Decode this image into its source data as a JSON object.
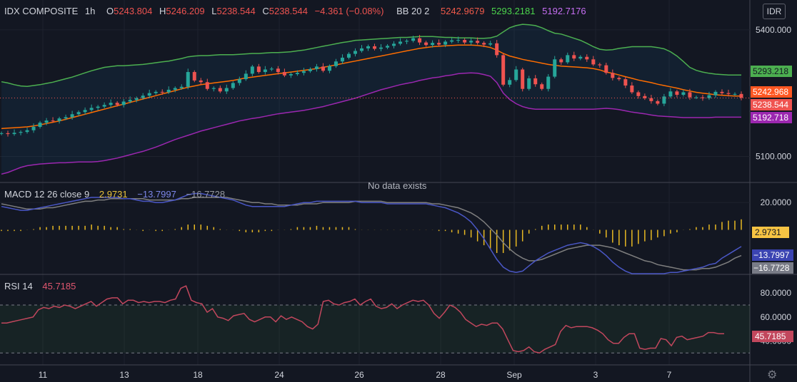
{
  "header": {
    "symbol": "IDX COMPOSITE",
    "interval": "1h",
    "o_label": "O",
    "o_value": "5243.804",
    "h_label": "H",
    "h_value": "5246.209",
    "l_label": "L",
    "l_value": "5238.544",
    "c_label": "C",
    "c_value": "5238.544",
    "change": "−4.361 (−0.08%)",
    "bb_label": "BB 20 2",
    "bb_mid": "5242.9679",
    "bb_upper": "5293.2181",
    "bb_lower": "5192.7176",
    "currency": "IDR"
  },
  "macd": {
    "label": "MACD 12 26 close 9",
    "hist": "2.9731",
    "macd": "−13.7997",
    "signal": "−16.7728",
    "no_data": "No data exists"
  },
  "rsi": {
    "label": "RSI 14",
    "value": "45.7185"
  },
  "colors": {
    "background": "#131722",
    "up": "#26a69a",
    "down": "#ef5350",
    "bb_upper": "#4caf50",
    "bb_mid": "#ff6d00",
    "bb_lower": "#9c27b0",
    "macd_line": "#4a57c6",
    "signal_line": "#7f7f7f",
    "histogram": "#e8b923",
    "rsi_line": "#c2475d"
  },
  "chart_data": [
    {
      "type": "candlestick",
      "title": "IDX COMPOSITE, 1h",
      "x_labels": [
        "11",
        "13",
        "18",
        "24",
        "26",
        "28",
        "Sep",
        "3",
        "7"
      ],
      "y_ticks": [
        "5400.000",
        "5100.000"
      ],
      "ylim": [
        5040,
        5420
      ],
      "price_tags": {
        "bb_upper": "5293.218",
        "bb_mid": "5242.968",
        "close": "5238.544",
        "bb_lower": "5192.718"
      },
      "close": [
        5155,
        5153,
        5156,
        5158,
        5162,
        5170,
        5180,
        5185,
        5184,
        5190,
        5193,
        5200,
        5205,
        5210,
        5215,
        5218,
        5222,
        5227,
        5222,
        5230,
        5234,
        5238,
        5244,
        5250,
        5253,
        5252,
        5258,
        5262,
        5265,
        5300,
        5280,
        5276,
        5260,
        5262,
        5254,
        5262,
        5274,
        5283,
        5296,
        5313,
        5300,
        5306,
        5308,
        5300,
        5292,
        5295,
        5298,
        5302,
        5307,
        5313,
        5303,
        5314,
        5325,
        5334,
        5343,
        5350,
        5356,
        5361,
        5355,
        5358,
        5362,
        5367,
        5372,
        5374,
        5380,
        5370,
        5364,
        5369,
        5365,
        5372,
        5375,
        5376,
        5370,
        5374,
        5369,
        5365,
        5368,
        5340,
        5270,
        5281,
        5306,
        5260,
        5285,
        5271,
        5260,
        5289,
        5330,
        5323,
        5340,
        5332,
        5336,
        5330,
        5318,
        5316,
        5298,
        5286,
        5283,
        5268,
        5252,
        5243,
        5238,
        5231,
        5225,
        5242,
        5254,
        5246,
        5252,
        5240,
        5240,
        5238,
        5245,
        5253,
        5250,
        5248,
        5248,
        5239
      ],
      "series": [
        {
          "name": "BB 20 2 upper",
          "values": [
            5277,
            5274,
            5270,
            5267,
            5266,
            5268,
            5270,
            5273,
            5276,
            5280,
            5284,
            5288,
            5293,
            5298,
            5303,
            5307,
            5311,
            5313,
            5315,
            5315,
            5316,
            5317,
            5318,
            5320,
            5322,
            5324,
            5326,
            5329,
            5332,
            5336,
            5338,
            5339,
            5339,
            5340,
            5341,
            5341,
            5341,
            5342,
            5343,
            5344,
            5344,
            5345,
            5346,
            5346,
            5347,
            5348,
            5350,
            5352,
            5355,
            5358,
            5361,
            5364,
            5367,
            5370,
            5372,
            5375,
            5376,
            5377,
            5378,
            5379,
            5380,
            5381,
            5382,
            5382,
            5383,
            5384,
            5384,
            5384,
            5383,
            5382,
            5382,
            5381,
            5381,
            5381,
            5380,
            5380,
            5381,
            5385,
            5395,
            5405,
            5410,
            5413,
            5412,
            5410,
            5405,
            5398,
            5392,
            5390,
            5385,
            5380,
            5375,
            5368,
            5360,
            5354,
            5352,
            5353,
            5356,
            5358,
            5360,
            5360,
            5360,
            5360,
            5358,
            5355,
            5348,
            5338,
            5325,
            5311,
            5304,
            5300,
            5297,
            5295,
            5294,
            5293,
            5293,
            5293
          ]
        },
        {
          "name": "BB 20 2 basis",
          "values": [
            5166,
            5167,
            5168,
            5169,
            5170,
            5172,
            5175,
            5178,
            5181,
            5184,
            5188,
            5192,
            5196,
            5200,
            5204,
            5208,
            5212,
            5216,
            5220,
            5224,
            5228,
            5232,
            5236,
            5240,
            5244,
            5248,
            5252,
            5256,
            5260,
            5264,
            5267,
            5270,
            5272,
            5274,
            5276,
            5278,
            5280,
            5283,
            5286,
            5288,
            5290,
            5292,
            5294,
            5296,
            5298,
            5300,
            5302,
            5304,
            5306,
            5308,
            5311,
            5314,
            5317,
            5320,
            5323,
            5326,
            5329,
            5332,
            5335,
            5338,
            5341,
            5344,
            5347,
            5350,
            5353,
            5356,
            5358,
            5360,
            5361,
            5362,
            5363,
            5364,
            5364,
            5364,
            5363,
            5361,
            5358,
            5352,
            5344,
            5338,
            5334,
            5330,
            5327,
            5324,
            5321,
            5318,
            5316,
            5314,
            5313,
            5312,
            5311,
            5310,
            5308,
            5305,
            5300,
            5297,
            5293,
            5289,
            5285,
            5281,
            5278,
            5275,
            5271,
            5268,
            5265,
            5262,
            5258,
            5255,
            5252,
            5250,
            5248,
            5246,
            5245,
            5244,
            5243,
            5243
          ]
        },
        {
          "name": "BB 20 2 lower",
          "values": [
            5058,
            5062,
            5068,
            5074,
            5078,
            5080,
            5082,
            5083,
            5084,
            5085,
            5085,
            5086,
            5087,
            5087,
            5087,
            5088,
            5090,
            5093,
            5096,
            5100,
            5104,
            5108,
            5112,
            5117,
            5122,
            5128,
            5134,
            5140,
            5145,
            5150,
            5155,
            5160,
            5164,
            5168,
            5172,
            5176,
            5180,
            5184,
            5187,
            5190,
            5192,
            5195,
            5198,
            5201,
            5203,
            5205,
            5207,
            5209,
            5212,
            5215,
            5218,
            5222,
            5226,
            5230,
            5234,
            5238,
            5243,
            5248,
            5253,
            5258,
            5262,
            5266,
            5270,
            5273,
            5276,
            5280,
            5283,
            5286,
            5288,
            5291,
            5293,
            5296,
            5297,
            5298,
            5297,
            5294,
            5290,
            5275,
            5250,
            5235,
            5225,
            5218,
            5214,
            5212,
            5212,
            5212,
            5212,
            5212,
            5212,
            5212,
            5212,
            5212,
            5212,
            5213,
            5214,
            5213,
            5211,
            5208,
            5205,
            5203,
            5201,
            5198,
            5196,
            5195,
            5194,
            5193,
            5192,
            5192,
            5192,
            5192,
            5192,
            5193,
            5193,
            5193,
            5193,
            5193
          ]
        }
      ]
    },
    {
      "type": "line",
      "title": "MACD 12 26 close 9",
      "y_ticks": [
        "20.0000"
      ],
      "price_tags": {
        "histogram": "2.9731",
        "macd": "−13.7997",
        "signal": "−16.7728"
      },
      "ylim": [
        -35,
        35
      ],
      "series": [
        {
          "name": "MACD",
          "values": [
            17,
            16,
            15,
            14,
            14,
            15,
            16,
            17,
            18,
            19,
            20,
            21,
            22,
            23,
            24,
            24,
            24,
            24,
            24,
            23,
            23,
            22,
            21,
            21,
            20,
            20,
            21,
            22,
            24,
            26,
            27,
            27,
            26,
            25,
            24,
            23,
            22,
            20,
            18,
            17,
            17,
            17,
            17,
            17,
            17,
            18,
            19,
            20,
            20,
            21,
            21,
            21,
            21,
            21,
            21,
            21,
            20,
            20,
            20,
            20,
            19,
            19,
            19,
            19,
            19,
            19,
            19,
            18,
            17,
            16,
            14,
            12,
            9,
            5,
            -1,
            -8,
            -16,
            -24,
            -30,
            -33,
            -34,
            -33,
            -29,
            -25,
            -22,
            -19,
            -17,
            -15,
            -13,
            -12,
            -11,
            -12,
            -14,
            -17,
            -21,
            -26,
            -30,
            -33,
            -35,
            -35,
            -35,
            -35,
            -35,
            -35,
            -34,
            -34,
            -33,
            -32,
            -31,
            -30,
            -28,
            -27,
            -23,
            -20,
            -17,
            -14
          ]
        },
        {
          "name": "Signal",
          "values": [
            19,
            18,
            17,
            16,
            15,
            15,
            15,
            16,
            16,
            17,
            18,
            19,
            20,
            21,
            21,
            22,
            22,
            23,
            23,
            23,
            23,
            23,
            23,
            22,
            22,
            22,
            22,
            22,
            23,
            23,
            24,
            24,
            24,
            24,
            24,
            24,
            23,
            22,
            21,
            20,
            20,
            19,
            19,
            18,
            18,
            18,
            18,
            19,
            19,
            19,
            20,
            20,
            20,
            20,
            20,
            21,
            21,
            21,
            21,
            21,
            20,
            20,
            20,
            20,
            20,
            20,
            20,
            19,
            19,
            18,
            17,
            16,
            14,
            12,
            9,
            5,
            0,
            -5,
            -11,
            -16,
            -20,
            -23,
            -25,
            -25,
            -24,
            -22,
            -20,
            -18,
            -16,
            -15,
            -14,
            -13,
            -13,
            -13,
            -14,
            -15,
            -17,
            -19,
            -21,
            -23,
            -25,
            -26,
            -28,
            -29,
            -30,
            -31,
            -32,
            -32,
            -32,
            -31,
            -31,
            -30,
            -28,
            -26,
            -23,
            -21
          ]
        },
        {
          "name": "Histogram",
          "values": [
            -2,
            -2,
            -2,
            -2,
            -1,
            0,
            1,
            1,
            2,
            2,
            2,
            2,
            2,
            2,
            3,
            2,
            2,
            1,
            1,
            0,
            0,
            -1,
            -2,
            -1,
            -2,
            -2,
            -1,
            0,
            1,
            3,
            3,
            3,
            2,
            1,
            0,
            -1,
            -1,
            -2,
            -3,
            -3,
            -3,
            -2,
            -2,
            -1,
            -1,
            0,
            1,
            1,
            1,
            2,
            1,
            1,
            1,
            1,
            1,
            0,
            -1,
            -1,
            -1,
            -1,
            -1,
            -1,
            -1,
            -1,
            -1,
            -1,
            -1,
            -1,
            -2,
            -2,
            -3,
            -4,
            -5,
            -7,
            -10,
            -13,
            -16,
            -19,
            -19,
            -17,
            -14,
            -10,
            -4,
            0,
            2,
            3,
            3,
            3,
            3,
            3,
            3,
            1,
            -1,
            -4,
            -7,
            -11,
            -13,
            -14,
            -14,
            -12,
            -10,
            -9,
            -7,
            -6,
            -4,
            -3,
            -1,
            0,
            1,
            1,
            3,
            3,
            5,
            6,
            6,
            7
          ]
        }
      ]
    },
    {
      "type": "line",
      "title": "RSI 14",
      "y_ticks": [
        "80.0000",
        "60.0000",
        "40.0000"
      ],
      "price_tags": {
        "rsi": "45.7185"
      },
      "ylim": [
        20,
        95
      ],
      "bands": [
        70,
        30
      ],
      "series": [
        {
          "name": "RSI 14",
          "values": [
            55,
            55,
            56,
            57,
            58,
            59,
            60,
            66,
            68,
            67,
            69,
            68,
            70,
            69,
            67,
            69,
            71,
            73,
            69,
            72,
            75,
            76,
            76,
            71,
            74,
            74,
            72,
            73,
            72,
            73,
            73,
            72,
            74,
            75,
            84,
            86,
            74,
            72,
            71,
            64,
            67,
            60,
            59,
            57,
            61,
            62,
            63,
            58,
            56,
            58,
            60,
            60,
            56,
            61,
            58,
            60,
            58,
            56,
            52,
            50,
            54,
            73,
            74,
            71,
            70,
            72,
            73,
            75,
            70,
            73,
            75,
            69,
            67,
            68,
            71,
            67,
            70,
            72,
            74,
            73,
            74,
            70,
            63,
            59,
            64,
            70,
            68,
            64,
            58,
            55,
            52,
            54,
            53,
            55,
            55,
            50,
            41,
            32,
            31,
            32,
            35,
            31,
            30,
            33,
            35,
            37,
            48,
            53,
            51,
            52,
            52,
            52,
            51,
            49,
            46,
            41,
            38,
            38,
            43,
            46,
            46,
            34,
            33,
            34,
            34,
            42,
            41,
            36,
            43,
            44,
            41,
            42,
            43,
            44,
            47,
            47,
            46,
            46
          ]
        }
      ]
    }
  ]
}
